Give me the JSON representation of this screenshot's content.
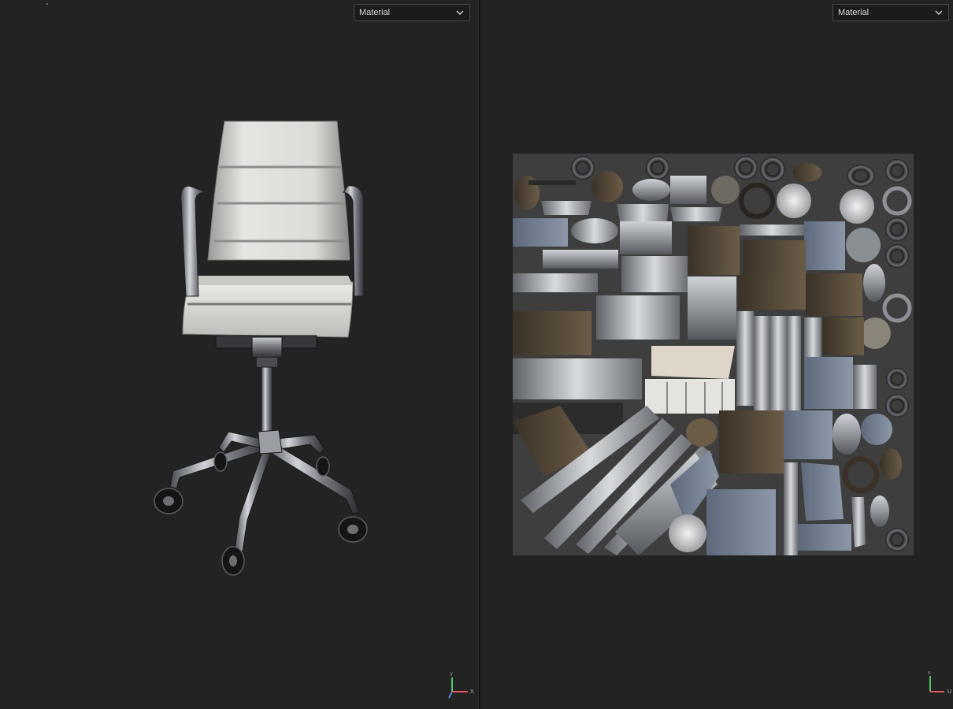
{
  "left_viewport": {
    "mode_select": {
      "value": "Material"
    },
    "axis_gizmo": {
      "vertical_label": "Y",
      "horizontal_label": "X"
    }
  },
  "right_viewport": {
    "mode_select": {
      "value": "Material"
    },
    "axis_gizmo": {
      "vertical_label": "V",
      "horizontal_label": "U"
    }
  },
  "colors": {
    "background": "#232323",
    "uv_sheet": "#3e3e3e",
    "chrome": "#b9bcc0",
    "cushion": "#d9d8d5",
    "axis_x": "#e05555",
    "axis_y": "#55c56a",
    "axis_z": "#5a7be0"
  },
  "icons": [
    "chevron-down-icon",
    "axis-gizmo-icon",
    "office-chair-model",
    "uv-texture-atlas"
  ]
}
